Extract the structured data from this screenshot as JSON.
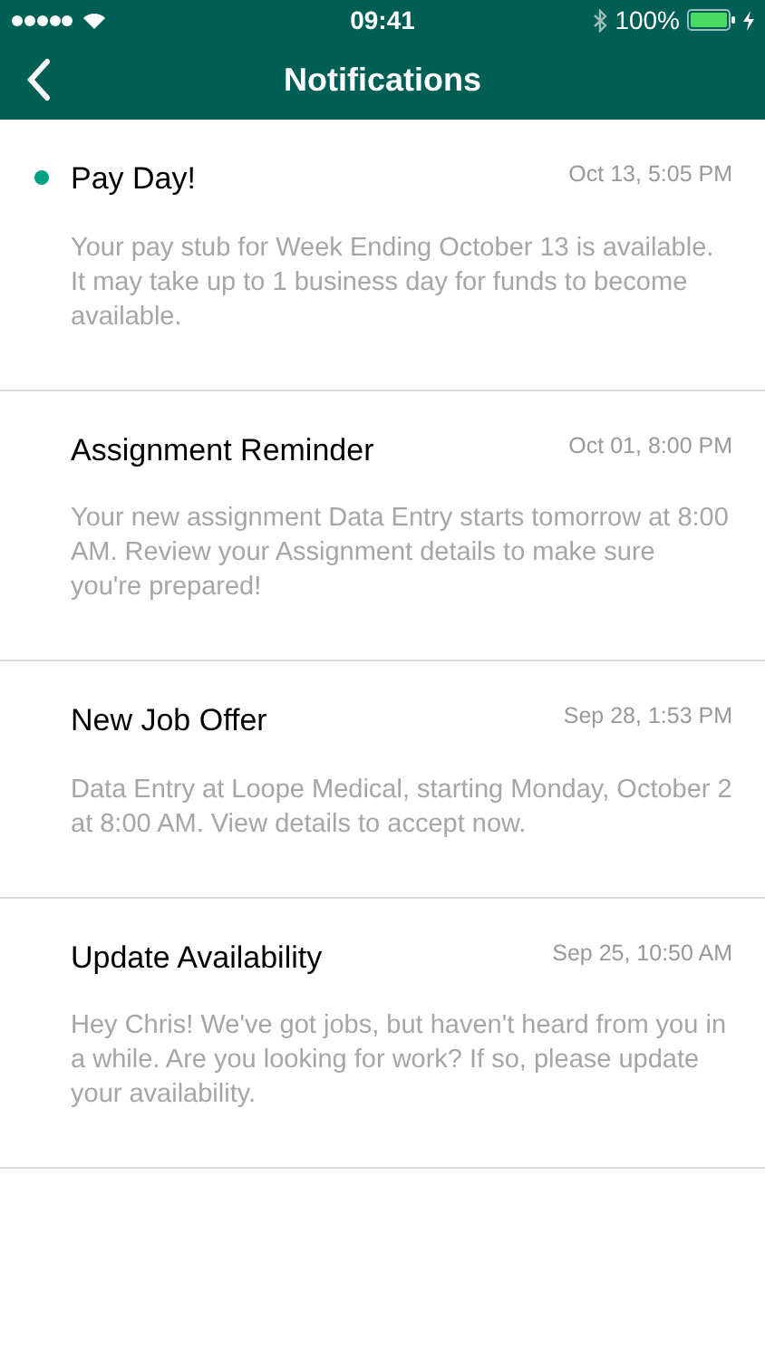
{
  "status_bar": {
    "time": "09:41",
    "battery": "100%"
  },
  "nav_bar": {
    "title": "Notifications"
  },
  "notifications": [
    {
      "title": "Pay Day!",
      "time": "Oct 13, 5:05 PM",
      "body": "Your pay stub for Week Ending October 13 is available. It may take up to 1 business day for funds to become available.",
      "unread": true
    },
    {
      "title": "Assignment Reminder",
      "time": "Oct 01, 8:00 PM",
      "body": "Your new assignment Data Entry starts tomorrow at 8:00 AM.  Review your Assignment details to make sure you're prepared!",
      "unread": false
    },
    {
      "title": "New Job Offer",
      "time": "Sep 28, 1:53 PM",
      "body": "Data Entry at Loope Medical, starting Monday, October 2 at 8:00 AM.  View details to accept now.",
      "unread": false
    },
    {
      "title": "Update Availability",
      "time": "Sep 25, 10:50 AM",
      "body": "Hey Chris!  We've got jobs, but haven't heard from you in a while.  Are you looking for work?  If so, please update your availability.",
      "unread": false
    }
  ]
}
